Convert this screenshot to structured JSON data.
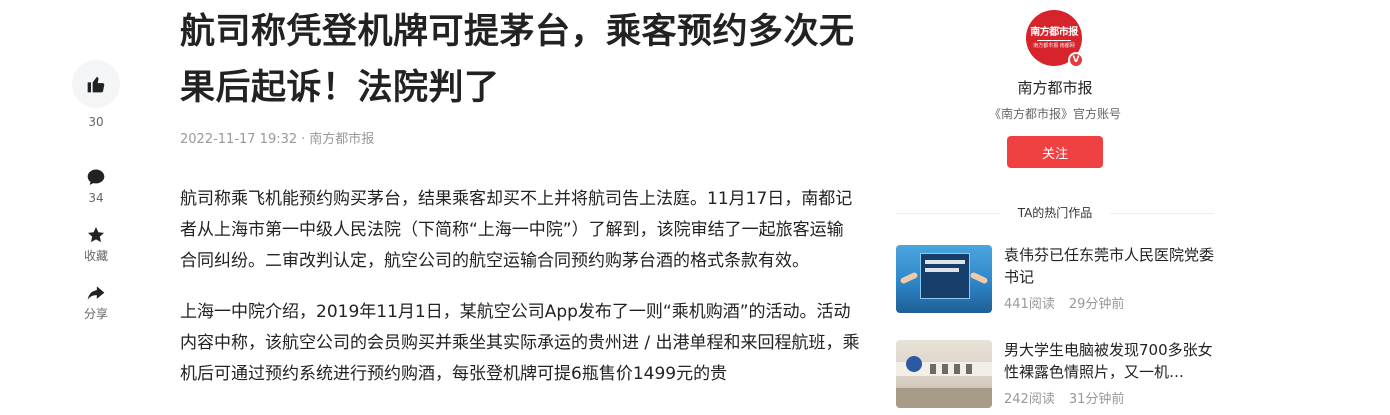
{
  "rail": {
    "like_count": "30",
    "comment_count": "34",
    "favorite_label": "收藏",
    "share_label": "分享"
  },
  "article": {
    "title": "航司称凭登机牌可提茅台，乘客预约多次无果后起诉！法院判了",
    "date": "2022-11-17 19:32",
    "separator": "·",
    "source": "南方都市报",
    "paragraphs": [
      "航司称乘飞机能预约购买茅台，结果乘客却买不上并将航司告上法庭。11月17日，南都记者从上海市第一中级人民法院（下简称“上海一中院”）了解到，该院审结了一起旅客运输合同纠纷。二审改判认定，航空公司的航空运输合同预约购茅台酒的格式条款有效。",
      "上海一中院介绍，2019年11月1日，某航空公司App发布了一则“乘机购酒”的活动。活动内容中称，该航空公司的会员购买并乘坐其实际承运的贵州进 / 出港单程和来回程航班，乘机后可通过预约系统进行预约购酒，每张登机牌可提6瓶售价1499元的贵"
    ]
  },
  "author": {
    "avatar_text": "南方都市报",
    "avatar_subtext": "南方都市报 南都网",
    "verified_mark": "V",
    "name": "南方都市报",
    "description": "《南方都市报》官方账号",
    "follow_label": "关注"
  },
  "hot": {
    "section_title": "TA的热门作品",
    "items": [
      {
        "headline": "袁伟芬已任东莞市人民医院党委书记",
        "reads": "441阅读",
        "time": "29分钟前"
      },
      {
        "headline": "男大学生电脑被发现700多张女性裸露色情照片，又一机…",
        "reads": "242阅读",
        "time": "31分钟前"
      }
    ]
  },
  "colors": {
    "accent_red": "#f04142",
    "brand_red": "#d7232a",
    "meta_gray": "#999999"
  },
  "icons": [
    "thumbs-up-icon",
    "comment-icon",
    "star-icon",
    "share-icon",
    "verified-icon"
  ]
}
